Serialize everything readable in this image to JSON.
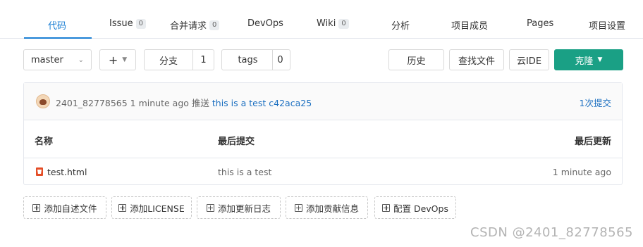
{
  "tabs": [
    {
      "label": "代码",
      "count": ""
    },
    {
      "label": "Issue",
      "count": "0"
    },
    {
      "label": "合并请求",
      "count": "0"
    },
    {
      "label": "DevOps",
      "count": ""
    },
    {
      "label": "Wiki",
      "count": "0"
    },
    {
      "label": "分析",
      "count": ""
    },
    {
      "label": "项目成员",
      "count": ""
    },
    {
      "label": "Pages",
      "count": ""
    },
    {
      "label": "项目设置",
      "count": ""
    }
  ],
  "toolbar": {
    "branch_select": "master",
    "plus_label": "+",
    "branches_label": "分支",
    "branches_count": "1",
    "tags_label": "tags",
    "tags_count": "0",
    "history_label": "历史",
    "find_file_label": "查找文件",
    "cloud_ide_label": "云IDE",
    "clone_label": "克隆"
  },
  "commit": {
    "author": "2401_82778565",
    "time": "1 minute ago",
    "action": "推送",
    "message": "this is a test",
    "hash": "c42aca25",
    "count_label": "1次提交"
  },
  "table": {
    "headers": {
      "name": "名称",
      "last_commit": "最后提交",
      "last_update": "最后更新"
    },
    "rows": [
      {
        "name": "test.html",
        "commit": "this is a test",
        "updated": "1 minute ago"
      }
    ]
  },
  "add_buttons": [
    "添加自述文件",
    "添加LICENSE",
    "添加更新日志",
    "添加贡献信息",
    "配置 DevOps"
  ],
  "watermark": "CSDN @2401_82778565",
  "colors": {
    "accent": "#1b7fd4",
    "primary": "#1aa085",
    "link": "#1b6fc0"
  }
}
